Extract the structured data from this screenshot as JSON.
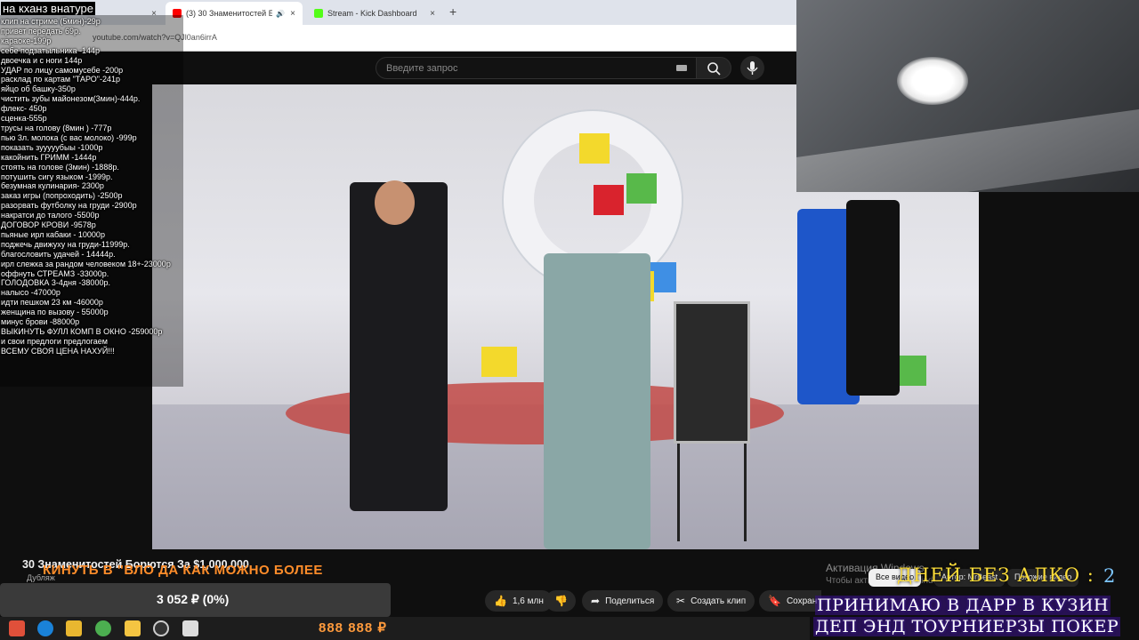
{
  "browser": {
    "tabs": [
      {
        "label": "(3) 30 Знаменитостей Бор",
        "active": true,
        "icon": "youtube-icon"
      },
      {
        "label": "Stream - Kick Dashboard",
        "active": false,
        "icon": "kick-icon"
      }
    ],
    "close_glyph": "×",
    "mute_glyph": "🔊",
    "new_tab_glyph": "+",
    "url": "youtube.com/watch?v=QJl0an6irrA"
  },
  "youtube": {
    "search_placeholder": "Введите запрос",
    "video_title": "30 Знаменитостей Борются За $1,000,000",
    "channel_name": "Дубляж",
    "actions": {
      "likes": "1,6 млн",
      "share": "Поделиться",
      "clip": "Создать клип",
      "save": "Сохран"
    },
    "recs_chips": {
      "all": "Все видео",
      "chip2": "Автор: MrBeast",
      "chip3": "Похожие видео"
    },
    "windows_activation": {
      "line1": "Активация Windows",
      "line2": "Чтобы активировать Windows, перейдите"
    }
  },
  "overlay": {
    "title": "на кханз внатуре",
    "items": [
      "клип на стриме (5мин)-29р",
      "привет передать 69р.",
      "караоке-199р",
      "себе подзатыльника -144р",
      "двоечка и с ноги 144р",
      "УДАР по лицу самомусебе -200р",
      "расклад по картам \"ТАРО\"-241р",
      "яйцо об башку-350р",
      "чистить зубы майонезом(3мин)-444р.",
      "флекс- 450р",
      "сценка-555р",
      "трусы на голову (8мин ) -777р",
      "пью 3л. молока (с вас молоко) -999р",
      "показать зууууубыы -1000р",
      "какойнить ГРИММ -1444р",
      "стоять на голове (3мин) -1888р.",
      "потушить сигу языком -1999р.",
      "безумная кулинария- 2300р",
      "заказ игры (попроходить) -2500р",
      "разорвать футболку на груди -2900р",
      "накратси до талого -5500р",
      "ДОГОВОР КРОВИ -9578р",
      "пьяные ирл кабаки - 10000р",
      "поджечь движуху на груди-11999р.",
      "благословить удачей - 14444р.",
      "ирл слежка за рандом человеком 18+-23000р",
      "оффнуть СТРЕАМЗ -33000р.",
      "ГОЛОДОВКА 3-4дня -38000р.",
      "налысо -47000р",
      "идти пешком 23 км -46000р",
      "женщина по вызову - 55000р",
      "минус брови -88000р",
      "ВЫКИНУТЬ ФУЛЛ КОМП В ОКНО -259000р",
      "и свои предлоги предлогаем",
      "ВСЕМУ СВОЯ ЦЕНА НАХУЙ!!!"
    ]
  },
  "stream_overlay": {
    "kinut_text": "КИНУТЬ В \"ВЛО ДА КАК МОЖНО БОЛЕЕ",
    "donation_bar": "3 052 ₽ (0%)",
    "days_label": "ДНЕЙ БЕЗ АЛКО :",
    "days_count": "2",
    "deposit_line1": "ПРИНИМАЮ В ДАРР В КУЗИН",
    "deposit_line2": "ДЕП ЭНД ТОУРНИЕРЗЫ ПОКЕР",
    "money": "888 888 ₽"
  },
  "colors": {
    "youtube_red": "#ff0000",
    "kick_green": "#53fc18",
    "accent_orange": "#ff8d2a",
    "days_yellow": "#ffdf3a"
  }
}
